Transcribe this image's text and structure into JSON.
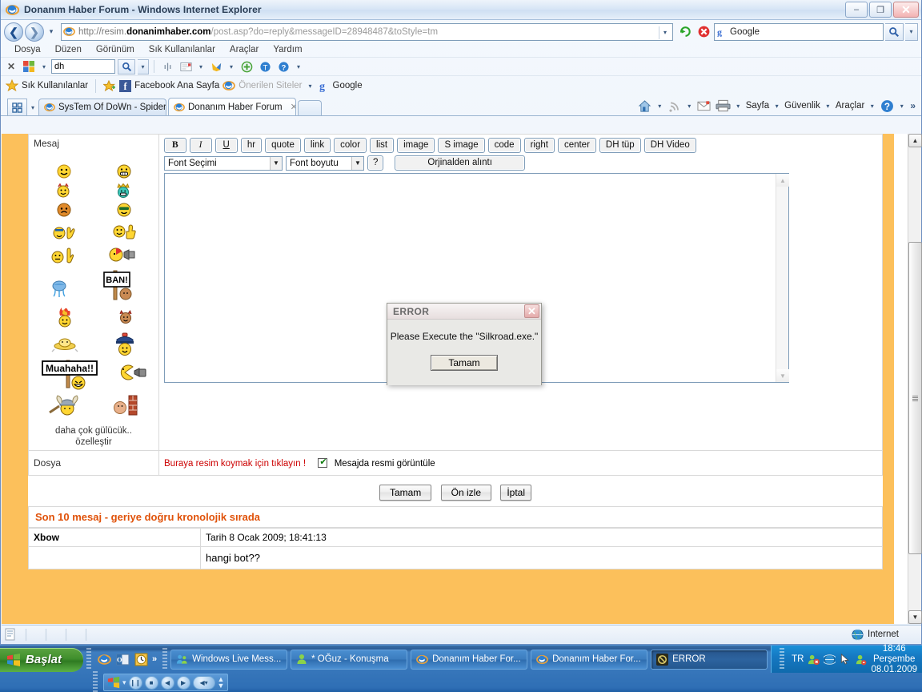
{
  "window": {
    "title": "Donanım Haber Forum - Windows Internet Explorer",
    "minimize": "–",
    "maximize": "❐",
    "close": "✕"
  },
  "nav": {
    "back_icon": "back-arrow-icon",
    "forward_icon": "forward-arrow-icon",
    "history_caret": "▾",
    "address": {
      "lead": "http://resim.",
      "domain": "donanimhaber.com",
      "rest": "/post.asp?do=reply&messageID=28948487&toStyle=tm",
      "dropdown_caret": "▾"
    },
    "refresh_icon": "refresh-icon",
    "stop_icon": "stop-icon",
    "search": {
      "value": "Google",
      "go_icon": "search-icon",
      "caret": "▾"
    }
  },
  "menubar": {
    "items": [
      "Dosya",
      "Düzen",
      "Görünüm",
      "Sık Kullanılanlar",
      "Araçlar",
      "Yardım"
    ]
  },
  "google_toolbar": {
    "close": "✕",
    "logo_caret": "▾",
    "input_value": "dh",
    "search_caret": "▾",
    "buttons": [
      "highlight-icon",
      "autofill-icon",
      "bookmarks-icon",
      "plus-icon",
      "translate-icon",
      "help-icon"
    ],
    "trailing_caret": "▾"
  },
  "favorites_bar": {
    "label": "Sık Kullanılanlar",
    "items": [
      {
        "label": "Facebook Ana Sayfa",
        "icon": "facebook-icon",
        "gray": false
      },
      {
        "label": "Önerilen Siteler",
        "icon": "ie-icon",
        "gray": true,
        "caret": "▾"
      },
      {
        "label": "Google",
        "icon": "google-g-icon",
        "gray": false
      }
    ]
  },
  "tabstrip": {
    "quick_tabs_icon": "quick-tabs-icon",
    "quick_tabs_caret": "▾",
    "tabs": [
      {
        "label": "SysTem Of DoWn - SpiderS (...",
        "active": false,
        "close": ""
      },
      {
        "label": "Donanım Haber Forum",
        "active": true,
        "close": "✕"
      }
    ],
    "command_bar": {
      "home_caret": "▾",
      "feeds_caret": "▾",
      "print_caret": "▾",
      "items": [
        "Sayfa",
        "Güvenlik",
        "Araçlar"
      ],
      "help_caret": "▾",
      "overflow": "»"
    }
  },
  "forum": {
    "message_label": "Mesaj",
    "smileys": [
      [
        "smiley-happy",
        "smiley-grin-teeth"
      ],
      [
        "smiley-devil-horns",
        "smiley-king-crown"
      ],
      [
        "smiley-orange-sad",
        "smiley-sunglasses"
      ],
      [
        "smiley-rock-hand",
        "smiley-thumbs-up"
      ],
      [
        "smiley-pointing-finger",
        "smiley-megaphone"
      ],
      [
        "smiley-crying-blue",
        "smiley-ban-sign"
      ],
      [
        "smiley-on-fire",
        "smiley-devil-face"
      ],
      [
        "smiley-ufo-hat",
        "smiley-police-cop"
      ],
      [
        "smiley-muahaha-sign",
        "smiley-pacman-camera"
      ],
      [
        "smiley-viking-helmet",
        "smiley-brick-wall"
      ]
    ],
    "smiley_more": "daha çok gülücük..",
    "smiley_customize": "özelleştir",
    "editor_buttons": [
      "B",
      "I",
      "U",
      "hr",
      "quote",
      "link",
      "color",
      "list",
      "image",
      "S image",
      "code",
      "right",
      "center",
      "DH tüp",
      "DH Video"
    ],
    "font_select": "Font Seçimi",
    "size_select": "Font boyutu",
    "help_button": "?",
    "quote_button": "Orjinalden alıntı",
    "textarea_value": "",
    "file_label": "Dosya",
    "file_link": "Buraya resim koymak için tıklayın !",
    "show_image_label": "Mesajda resmi görüntüle",
    "show_image_checked": true,
    "action_buttons": [
      "Tamam",
      "Ön izle",
      "İptal"
    ],
    "last_messages_header": "Son 10 mesaj - geriye doğru kronolojik sırada",
    "messages": [
      {
        "user": "Xbow",
        "date": "Tarih 8 Ocak 2009; 18:41:13",
        "body": "hangi bot??"
      }
    ]
  },
  "dialog": {
    "title": "ERROR",
    "close": "✕",
    "message": "Please Execute the \"Silkroad.exe.\"",
    "ok_button": "Tamam"
  },
  "statusbar": {
    "icon": "page-icon",
    "zone_label": "Internet",
    "zone_icon": "globe-icon"
  },
  "taskbar": {
    "start_label": "Başlat",
    "quicklaunch": [
      "ie-icon",
      "outlook-icon",
      "clock-icon"
    ],
    "quicklaunch_overflow": "»",
    "buttons": [
      {
        "label": "Windows Live Mess...",
        "icon": "msn-people-icon",
        "pressed": false
      },
      {
        "label": "* OĞuz  - Konuşma",
        "icon": "msn-contact-icon",
        "pressed": false
      },
      {
        "label": "Donanım Haber For...",
        "icon": "ie-icon",
        "pressed": false
      },
      {
        "label": "Donanım Haber For...",
        "icon": "ie-icon",
        "pressed": false
      },
      {
        "label": "ERROR",
        "icon": "error-app-icon",
        "pressed": true
      }
    ],
    "lang": "TR",
    "tray_icons": [
      "msn-tray-icon",
      "network-tray-icon",
      "msn-contact-tray-icon"
    ],
    "time": "18:46",
    "day": "Perşembe",
    "date": "08.01.2009",
    "media_controls": [
      "pause",
      "stop",
      "prev",
      "next",
      "volume"
    ]
  },
  "colors": {
    "page_orange": "#FCC05B",
    "header_orange": "#e0520a",
    "link_red": "#cc0000"
  }
}
